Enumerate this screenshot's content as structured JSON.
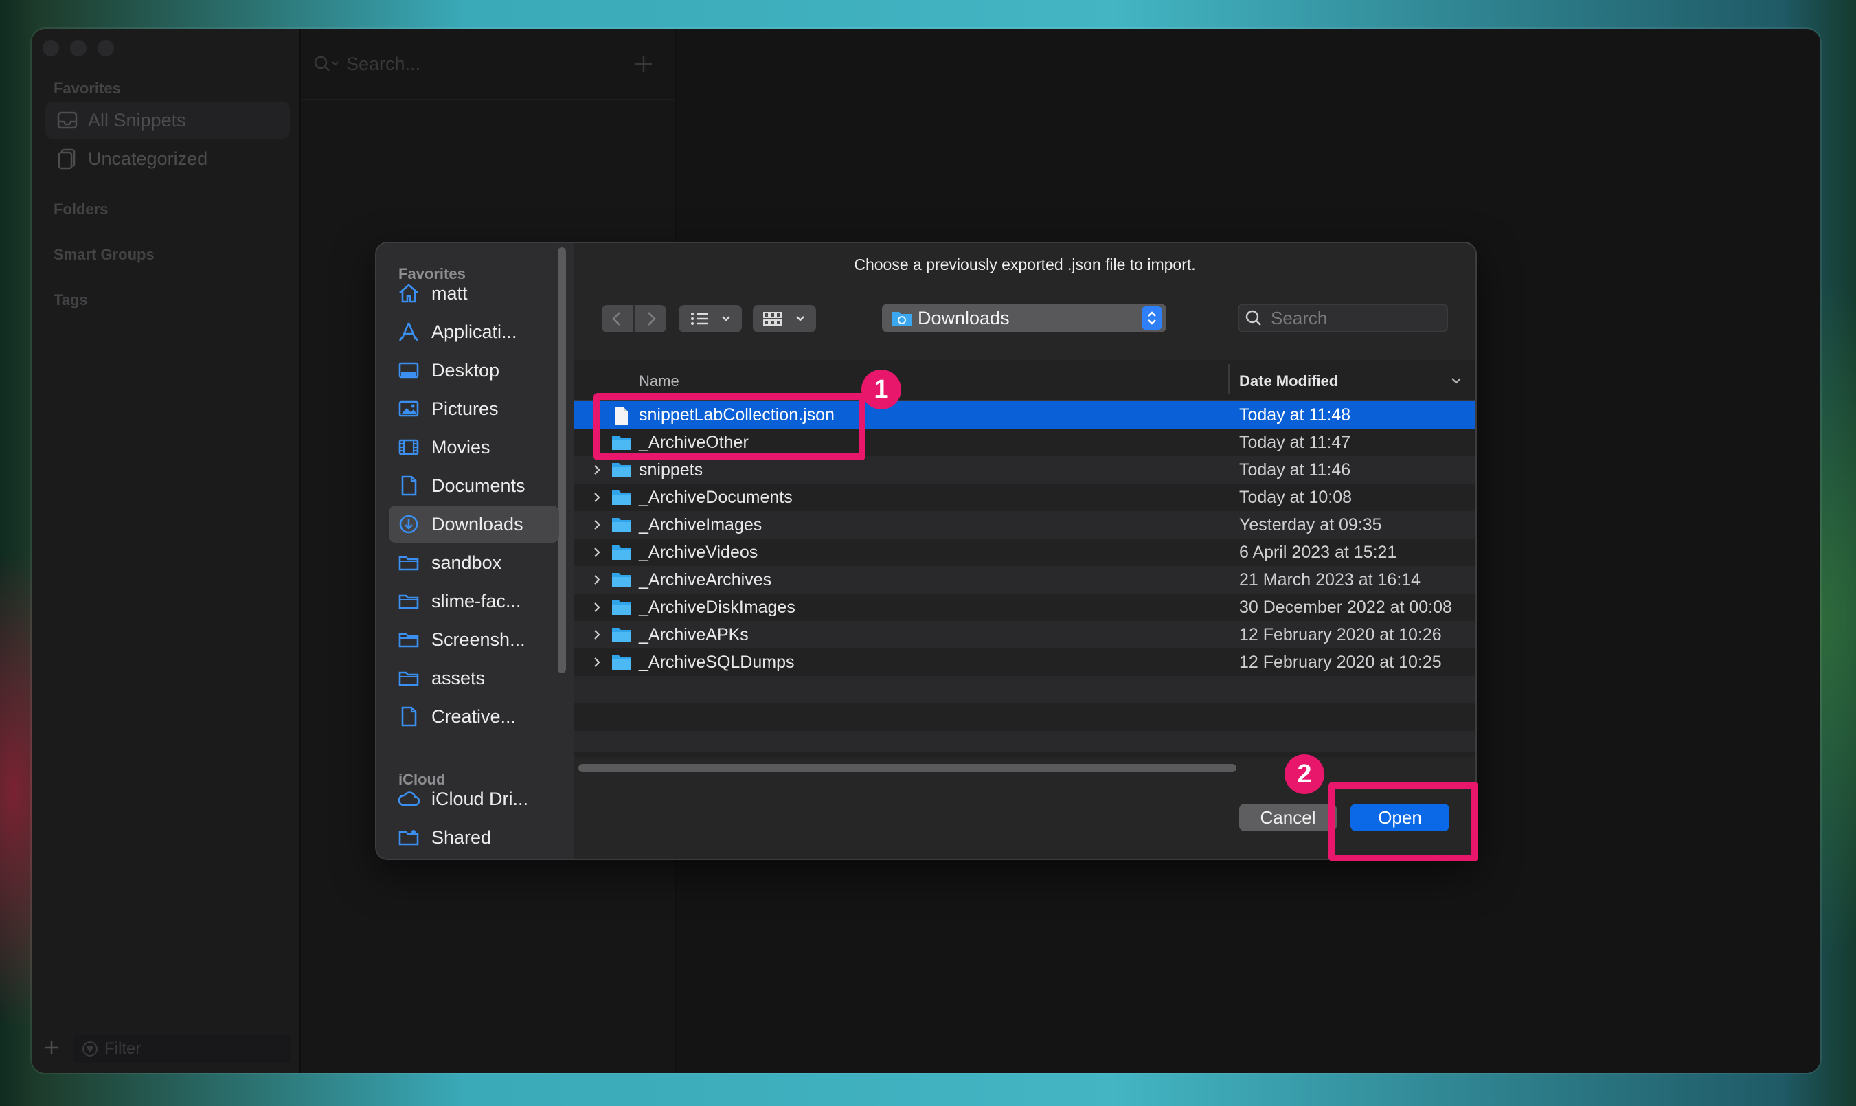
{
  "background": {
    "description_colors": [
      "#43b5c3",
      "#1d3b2a",
      "#7a2233"
    ]
  },
  "app": {
    "sidebar": {
      "favorites_heading": "Favorites",
      "items": [
        {
          "label": "All Snippets",
          "icon": "tray-icon"
        },
        {
          "label": "Uncategorized",
          "icon": "document-stack-icon"
        }
      ],
      "folders_heading": "Folders",
      "smart_groups_heading": "Smart Groups",
      "tags_heading": "Tags",
      "filter_placeholder": "Filter"
    },
    "list": {
      "search_placeholder": "Search..."
    }
  },
  "dialog": {
    "prompt": "Choose a previously exported .json file to import.",
    "sidebar": {
      "favorites_heading": "Favorites",
      "favorites": [
        {
          "label": "matt",
          "icon": "home-icon"
        },
        {
          "label": "Applicati...",
          "icon": "applications-icon"
        },
        {
          "label": "Desktop",
          "icon": "desktop-icon"
        },
        {
          "label": "Pictures",
          "icon": "pictures-icon"
        },
        {
          "label": "Movies",
          "icon": "movies-icon"
        },
        {
          "label": "Documents",
          "icon": "document-icon"
        },
        {
          "label": "Downloads",
          "icon": "downloads-icon",
          "active": true
        },
        {
          "label": "sandbox",
          "icon": "folder-icon"
        },
        {
          "label": "slime-fac...",
          "icon": "folder-icon"
        },
        {
          "label": "Screensh...",
          "icon": "folder-icon"
        },
        {
          "label": "assets",
          "icon": "folder-icon"
        },
        {
          "label": "Creative...",
          "icon": "document-icon"
        }
      ],
      "icloud_heading": "iCloud",
      "icloud": [
        {
          "label": "iCloud Dri...",
          "icon": "cloud-icon"
        },
        {
          "label": "Shared",
          "icon": "shared-folder-icon"
        }
      ]
    },
    "toolbar": {
      "location": "Downloads",
      "search_placeholder": "Search"
    },
    "columns": {
      "name": "Name",
      "date_modified": "Date Modified"
    },
    "rows": [
      {
        "name": "snippetLabCollection.json",
        "date": "Today at 11:48",
        "type": "file",
        "selected": true
      },
      {
        "name": "_ArchiveOther",
        "date": "Today at 11:47",
        "type": "folder"
      },
      {
        "name": "snippets",
        "date": "Today at 11:46",
        "type": "folder"
      },
      {
        "name": "_ArchiveDocuments",
        "date": "Today at 10:08",
        "type": "folder"
      },
      {
        "name": "_ArchiveImages",
        "date": "Yesterday at 09:35",
        "type": "folder"
      },
      {
        "name": "_ArchiveVideos",
        "date": "6 April 2023 at 15:21",
        "type": "folder"
      },
      {
        "name": "_ArchiveArchives",
        "date": "21 March 2023 at 16:14",
        "type": "folder"
      },
      {
        "name": "_ArchiveDiskImages",
        "date": "30 December 2022 at 00:08",
        "type": "folder"
      },
      {
        "name": "_ArchiveAPKs",
        "date": "12 February 2020 at 10:26",
        "type": "folder"
      },
      {
        "name": "_ArchiveSQLDumps",
        "date": "12 February 2020 at 10:25",
        "type": "folder"
      }
    ],
    "buttons": {
      "cancel": "Cancel",
      "open": "Open"
    }
  },
  "annotations": {
    "step1": "1",
    "step2": "2",
    "highlight_color": "#e8176b"
  },
  "colors": {
    "accent": "#0b68e6",
    "selection": "#0a60d6"
  }
}
